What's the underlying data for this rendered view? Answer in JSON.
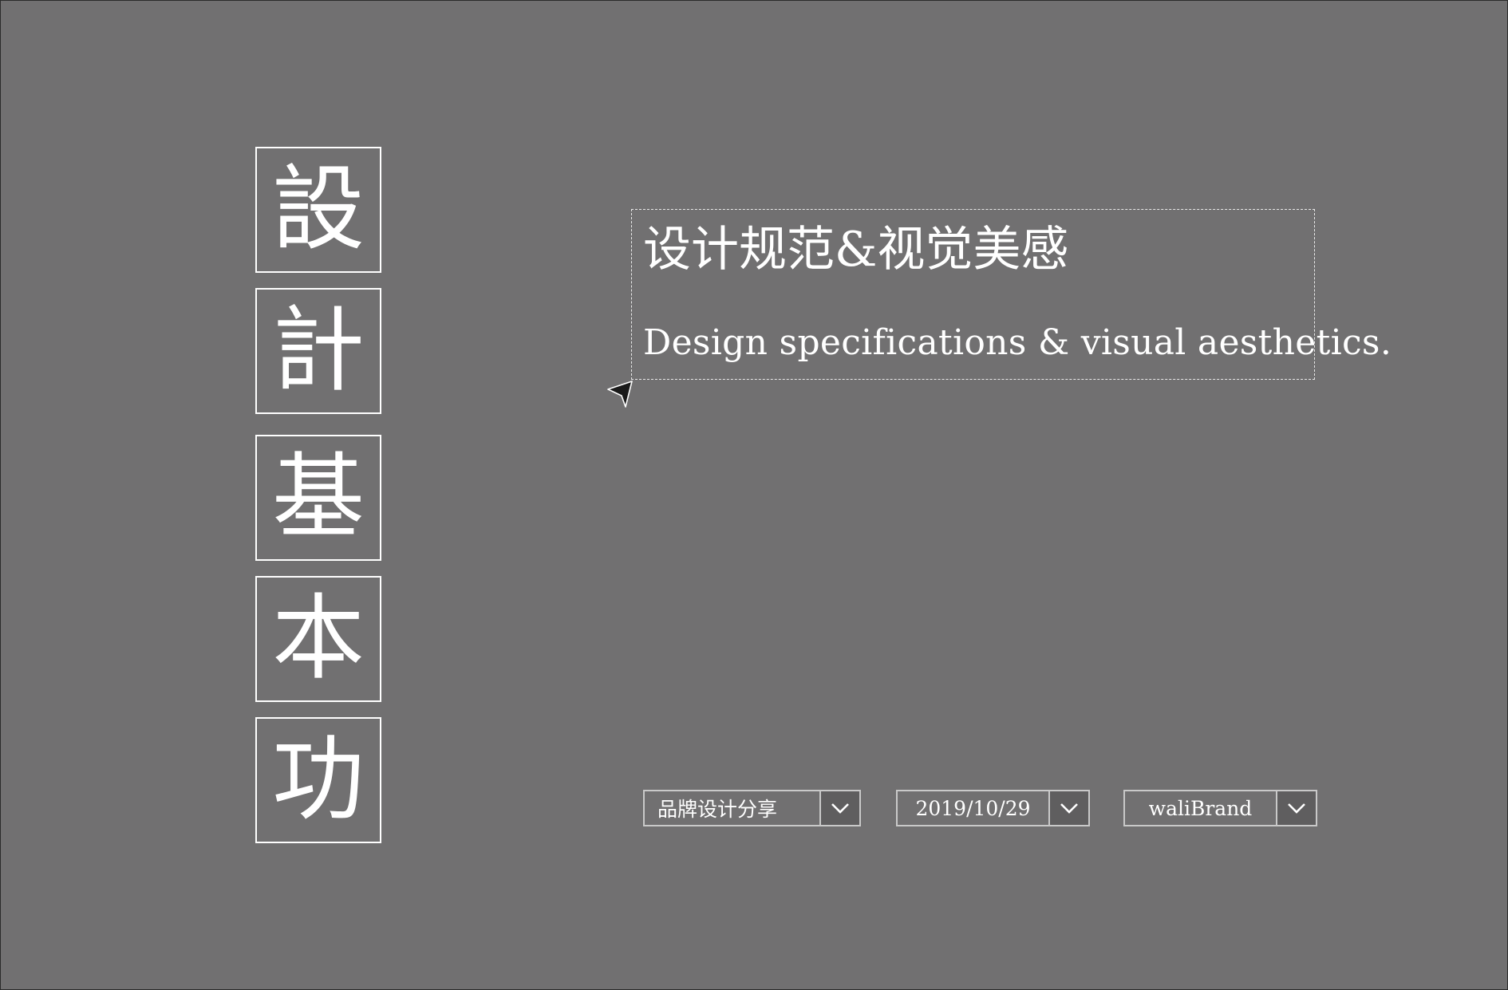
{
  "vertical_title": {
    "chars": [
      "設",
      "計",
      "基",
      "本",
      "功"
    ]
  },
  "textbox": {
    "heading_cn": "设计规范&视觉美感",
    "heading_en": "Design specifications & visual aesthetics."
  },
  "selects": [
    {
      "value": "品牌设计分享",
      "icon": "chevron-down-icon"
    },
    {
      "value": "2019/10/29",
      "icon": "chevron-down-icon"
    },
    {
      "value": "waliBrand",
      "icon": "chevron-down-icon"
    }
  ],
  "colors": {
    "background": "#717071",
    "foreground": "#ffffff",
    "dropdown_border": "#c9c9c9"
  }
}
